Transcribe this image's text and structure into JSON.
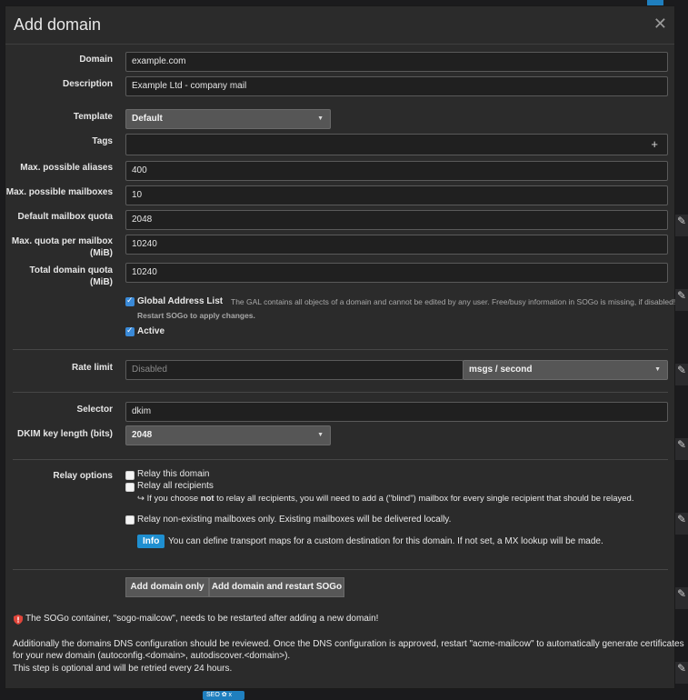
{
  "modal": {
    "title": "Add domain",
    "close_icon": "close-icon"
  },
  "form": {
    "domain": {
      "label": "Domain",
      "value": "example.com"
    },
    "description": {
      "label": "Description",
      "value": "Example Ltd - company mail"
    },
    "template": {
      "label": "Template",
      "value": "Default"
    },
    "tags": {
      "label": "Tags",
      "add_symbol": "+"
    },
    "max_aliases": {
      "label": "Max. possible aliases",
      "value": "400"
    },
    "max_mailboxes": {
      "label": "Max. possible mailboxes",
      "value": "10"
    },
    "default_quota": {
      "label": "Default mailbox quota",
      "value": "2048"
    },
    "max_quota": {
      "label": "Max. quota per mailbox (MiB)",
      "value": "10240"
    },
    "total_quota": {
      "label": "Total domain quota (MiB)",
      "value": "10240"
    },
    "gal": {
      "label": "Global Address List",
      "note": "The GAL contains all objects of a domain and cannot be edited by any user. Free/busy information in SOGo is missing, if disabled!",
      "note2": "Restart SOGo to apply changes.",
      "checked": true
    },
    "active": {
      "label": "Active",
      "checked": true
    },
    "rate_limit": {
      "label": "Rate limit",
      "placeholder": "Disabled",
      "unit": "msgs / second"
    },
    "selector": {
      "label": "Selector",
      "value": "dkim"
    },
    "dkim_length": {
      "label": "DKIM key length (bits)",
      "value": "2048"
    },
    "relay": {
      "label": "Relay options",
      "relay_domain": "Relay this domain",
      "relay_all": "Relay all recipients",
      "hint_pre": "If you choose ",
      "hint_bold": "not",
      "hint_post": " to relay all recipients, you will need to add a (\"blind\") mailbox for every single recipient that should be relayed.",
      "relay_nonexisting": "Relay non-existing mailboxes only. Existing mailboxes will be delivered locally.",
      "info_badge": "Info",
      "info_text": "You can define transport maps for a custom destination for this domain. If not set, a MX lookup will be made."
    }
  },
  "buttons": {
    "add_only": "Add domain only",
    "add_restart": "Add domain and restart SOGo"
  },
  "footer": {
    "warning": "The SOGo container, \"sogo-mailcow\", needs to be restarted after adding a new domain!",
    "dns_line1": "Additionally the domains DNS configuration should be reviewed. Once the DNS configuration is approved, restart \"acme-mailcow\" to automatically generate certificates",
    "dns_line2": "for your new domain (autoconfig.<domain>, autodiscover.<domain>).",
    "dns_line3": "This step is optional and will be retried every 24 hours."
  },
  "background": {
    "badge": "SEO ✿ x"
  },
  "colors": {
    "accent": "#1f8fd0",
    "checkbox": "#3a8ad8",
    "warning": "#e0453a"
  }
}
